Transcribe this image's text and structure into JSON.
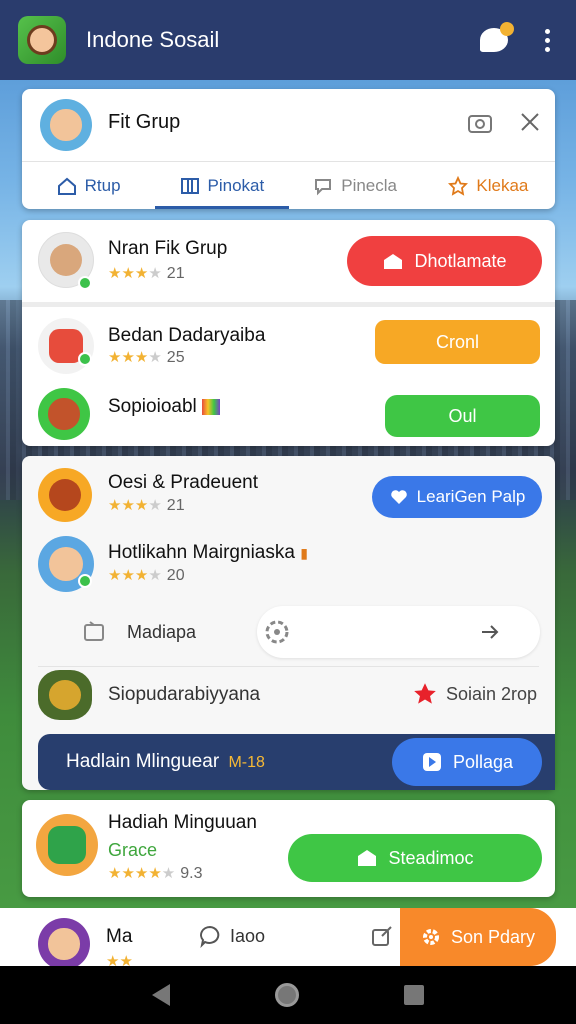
{
  "app": {
    "title": "Indone Sosail"
  },
  "header_card": {
    "title": "Fit Grup",
    "tabs": [
      {
        "label": "Rtup",
        "color": "#2c5ca8"
      },
      {
        "label": "Pinokat",
        "color": "#2c5ca8"
      },
      {
        "label": "Pinecla",
        "color": "#888888"
      },
      {
        "label": "Klekaa",
        "color": "#e07a1a"
      }
    ]
  },
  "card1": {
    "row1": {
      "name": "Nran Fik Grup",
      "rating": "21",
      "button": "Dhotlamate"
    },
    "row2": {
      "name": "Bedan Dadaryaiba",
      "rating": "25",
      "button": "Cronl"
    },
    "row3": {
      "name": "Sopioioabl",
      "button": "Oul"
    }
  },
  "card2": {
    "row1": {
      "name": "Oesi & Pradeuent",
      "rating": "21",
      "button": "LeariGen Palp"
    },
    "row2": {
      "name": "Hotlikahn Mairgniaska",
      "rating": "20"
    },
    "search": {
      "label": "Madiapa"
    },
    "row3": {
      "name": "Siopudarabiyyana",
      "status": "Soiain 2rop"
    },
    "banner": {
      "text": "Hadlain Mlinguear",
      "badge": "M-18",
      "button": "Pollaga"
    }
  },
  "card3": {
    "title": "Hadiah Minguuan",
    "subtitle": "Grace",
    "rating": "9.3",
    "button": "Steadimoc"
  },
  "bottom": {
    "name": "Ma",
    "chat_label": "Iaoo",
    "action": "Son Pdary"
  },
  "colors": {
    "red": "#f04040",
    "orange": "#f7a825",
    "green": "#3fc645",
    "blue": "#3a78e8",
    "navy": "#283e6e",
    "orange_action": "#f8892a"
  }
}
